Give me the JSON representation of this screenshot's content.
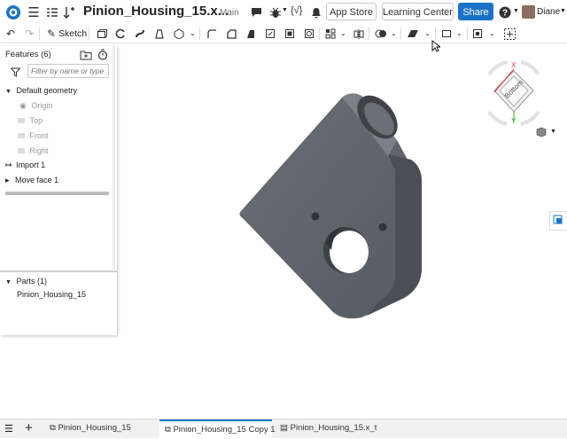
{
  "header": {
    "doc_title": "Pinion_Housing_15.x...",
    "branch": "Main",
    "app_store": "App Store",
    "learning_center": "Learning Center",
    "share": "Share",
    "user_name": "Diane"
  },
  "toolbar": {
    "sketch_label": "Sketch"
  },
  "features": {
    "title": "Features (6)",
    "filter_placeholder": "Filter by name or type",
    "default_geometry": "Default geometry",
    "items_default": [
      "Origin",
      "Top",
      "Front",
      "Right"
    ],
    "items": [
      "Import 1",
      "Move face 1"
    ]
  },
  "parts": {
    "title": "Parts (1)",
    "items": [
      "Pinion_Housing_15"
    ]
  },
  "viewcube": {
    "face_label": "Bottom",
    "axis_x": "X",
    "axis_y": "Y"
  },
  "tabs": {
    "items": [
      "Pinion_Housing_15",
      "Pinion_Housing_15 Copy 1",
      "Pinion_Housing_15.x_t"
    ],
    "active_index": 1
  },
  "colors": {
    "accent": "#1a73c8",
    "part_fill": "#5f646b"
  },
  "icons": [
    "onshape-logo-icon",
    "hamburger-menu-icon",
    "feature-list-icon",
    "variables-icon",
    "comment-icon",
    "bug-icon",
    "code-icon",
    "bell-icon",
    "help-icon",
    "undo-icon",
    "redo-icon",
    "pencil-icon",
    "filter-icon",
    "timer-icon",
    "add-folder-icon",
    "view-mode-icon",
    "plus-icon"
  ]
}
